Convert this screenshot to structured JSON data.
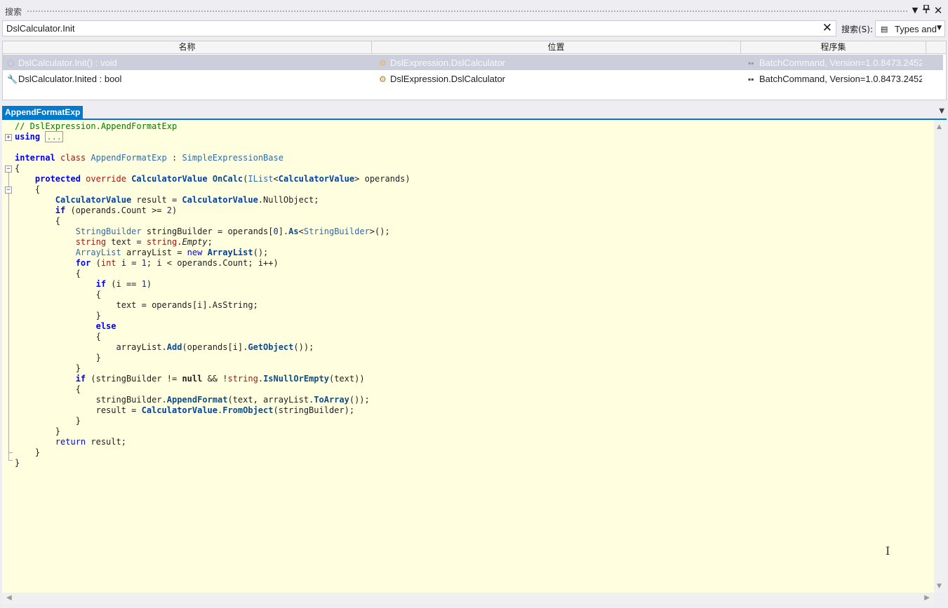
{
  "panel": {
    "title": "搜索",
    "dropdown_icon": "▾",
    "pin_icon": "pin-icon",
    "close_icon": "×"
  },
  "search": {
    "value": "DslCalculator.Init",
    "scope_label": "搜索(S):",
    "scope_value": "Types and Members"
  },
  "columns": [
    "名称",
    "位置",
    "程序集"
  ],
  "results": [
    {
      "name": "DslCalculator.Init() : void",
      "location": "DslExpression.DslCalculator",
      "assembly": "BatchCommand, Version=1.0.8473.2452"
    },
    {
      "name": "DslCalculator.Inited : bool",
      "location": "DslExpression.DslCalculator",
      "assembly": "BatchCommand, Version=1.0.8473.2452"
    }
  ],
  "document": {
    "tab": "AppendFormatExp"
  },
  "code": {
    "comment": "// DslExpression.AppendFormatExp",
    "using_kw": "using",
    "using_collapsed": "...",
    "class_decl": {
      "mod": "internal",
      "kw": "class",
      "name": "AppendFormatExp",
      "colon": " : ",
      "base": "SimpleExpressionBase"
    },
    "lines": {
      "brace_open": "{",
      "method_decl": {
        "p": "protected",
        "o": "override",
        "ret": "CalculatorValue",
        "name": "OnCalc",
        "open": "(",
        "ilist": "IList",
        "lt": "<",
        "arg": "CalculatorValue",
        "rest": "> operands)"
      },
      "l1": {
        "type": "CalculatorValue",
        "a": " result = ",
        "type2": "CalculatorValue",
        "b": ".NullObject;"
      },
      "l2": {
        "kw": "if",
        "a": " (operands.Count >= ",
        "num": "2",
        "b": ")"
      },
      "l3": {
        "type": "StringBuilder",
        "a": " stringBuilder = operands[",
        "num": "0",
        "b": "].",
        "m": "As",
        "lt": "<",
        "t2": "StringBuilder",
        "c": ">();"
      },
      "l4": {
        "kw": "string",
        "a": " text = ",
        "kw2": "string",
        "b": ".",
        "it": "Empty",
        "c": ";"
      },
      "l5": {
        "type": "ArrayList",
        "a": " arrayList = ",
        "kw": "new",
        "sp": " ",
        "t2": "ArrayList",
        "c": "();"
      },
      "l6": {
        "kw": "for",
        "a": " (",
        "kw2": "int",
        "b": " i = ",
        "num": "1",
        "c": "; i < operands.Count; i++)"
      },
      "l7": {
        "kw": "if",
        "a": " (i == ",
        "num": "1",
        "b": ")"
      },
      "l8": {
        "a": "text = operands[i].AsString;"
      },
      "l9": {
        "kw": "else"
      },
      "l10": {
        "a": "arrayList.",
        "m": "Add",
        "b": "(operands[i].",
        "m2": "GetObject",
        "c": "());"
      },
      "l11": {
        "kw": "if",
        "a": " (stringBuilder != ",
        "b": "null",
        "c": " && !",
        "kw2": "string",
        "d": ".",
        "m": "IsNullOrEmpty",
        "e": "(text))"
      },
      "l12": {
        "a": "stringBuilder.",
        "m": "AppendFormat",
        "b": "(text, arrayList.",
        "m2": "ToArray",
        "c": "());"
      },
      "l13": {
        "a": "result = ",
        "t": "CalculatorValue",
        "b": ".",
        "m": "FromObject",
        "c": "(stringBuilder);"
      },
      "l14": {
        "kw": "return",
        "a": " result;"
      }
    }
  },
  "colors": {
    "accent": "#007acc",
    "editor_bg": "#ffffe0",
    "selection": "#cccedb"
  }
}
